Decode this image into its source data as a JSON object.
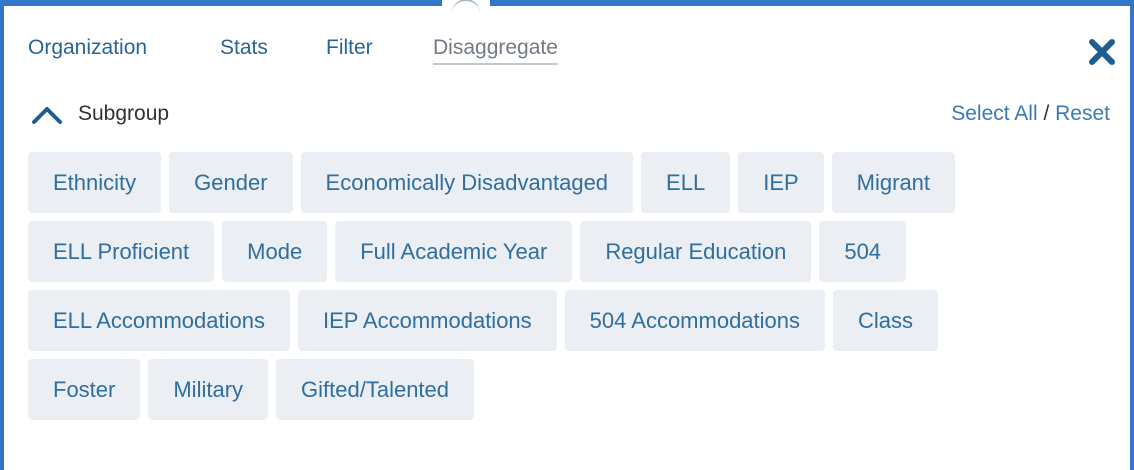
{
  "tabs": [
    {
      "label": "Organization",
      "active": false
    },
    {
      "label": "Stats",
      "active": false
    },
    {
      "label": "Filter",
      "active": false
    },
    {
      "label": "Disaggregate",
      "active": true
    }
  ],
  "close_icon": "close-x-icon",
  "subgroup": {
    "title": "Subgroup",
    "toggle_icon": "chevron-up-icon",
    "select_all": "Select All",
    "separator": " / ",
    "reset": "Reset",
    "rows": [
      [
        "Ethnicity",
        "Gender",
        "Economically Disadvantaged",
        "ELL",
        "IEP",
        "Migrant"
      ],
      [
        "ELL Proficient",
        "Mode",
        "Full Academic Year",
        "Regular Education",
        "504"
      ],
      [
        "ELL Accommodations",
        "IEP Accommodations",
        "504 Accommodations",
        "Class"
      ],
      [
        "Foster",
        "Military",
        "Gifted/Talented"
      ]
    ]
  },
  "colors": {
    "border": "#2f78c8",
    "tab_link": "#2a6496",
    "chip_bg": "#ebeff3",
    "chip_text": "#2f6e9e",
    "close": "#1d5e93"
  }
}
